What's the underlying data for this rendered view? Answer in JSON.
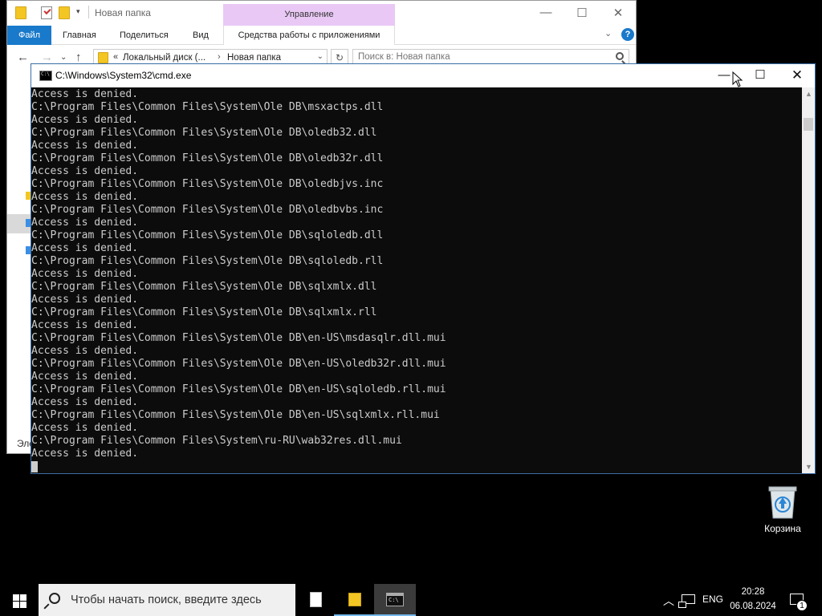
{
  "explorer": {
    "title": "Новая папка",
    "manage_tab": "Управление",
    "ribbon_tabs": [
      "Файл",
      "Главная",
      "Поделиться",
      "Вид"
    ],
    "app_tools_tab": "Средства работы с приложениями",
    "help_label": "?",
    "address": {
      "crumb_prefix": "«",
      "crumb1": "Локальный диск (...",
      "crumb_separator": "›",
      "crumb2": "Новая папка"
    },
    "search_placeholder": "Поиск в: Новая папка",
    "status_partial": "Эле"
  },
  "cmd": {
    "title": "C:\\Windows\\System32\\cmd.exe",
    "lines": [
      "Access is denied.",
      "C:\\Program Files\\Common Files\\System\\Ole DB\\msxactps.dll",
      "Access is denied.",
      "C:\\Program Files\\Common Files\\System\\Ole DB\\oledb32.dll",
      "Access is denied.",
      "C:\\Program Files\\Common Files\\System\\Ole DB\\oledb32r.dll",
      "Access is denied.",
      "C:\\Program Files\\Common Files\\System\\Ole DB\\oledbjvs.inc",
      "Access is denied.",
      "C:\\Program Files\\Common Files\\System\\Ole DB\\oledbvbs.inc",
      "Access is denied.",
      "C:\\Program Files\\Common Files\\System\\Ole DB\\sqloledb.dll",
      "Access is denied.",
      "C:\\Program Files\\Common Files\\System\\Ole DB\\sqloledb.rll",
      "Access is denied.",
      "C:\\Program Files\\Common Files\\System\\Ole DB\\sqlxmlx.dll",
      "Access is denied.",
      "C:\\Program Files\\Common Files\\System\\Ole DB\\sqlxmlx.rll",
      "Access is denied.",
      "C:\\Program Files\\Common Files\\System\\Ole DB\\en-US\\msdasqlr.dll.mui",
      "Access is denied.",
      "C:\\Program Files\\Common Files\\System\\Ole DB\\en-US\\oledb32r.dll.mui",
      "Access is denied.",
      "C:\\Program Files\\Common Files\\System\\Ole DB\\en-US\\sqloledb.rll.mui",
      "Access is denied.",
      "C:\\Program Files\\Common Files\\System\\Ole DB\\en-US\\sqlxmlx.rll.mui",
      "Access is denied.",
      "C:\\Program Files\\Common Files\\System\\ru-RU\\wab32res.dll.mui",
      "Access is denied."
    ]
  },
  "desktop": {
    "recycle_bin_label": "Корзина"
  },
  "taskbar": {
    "search_placeholder": "Чтобы начать поиск, введите здесь",
    "language": "ENG",
    "time": "20:28",
    "date": "06.08.2024",
    "notification_count": "1"
  },
  "colors": {
    "accent": "#1979ca",
    "manage_tab": "#e9c8f5",
    "console_bg": "#0c0c0c",
    "console_text": "#cccccc"
  }
}
